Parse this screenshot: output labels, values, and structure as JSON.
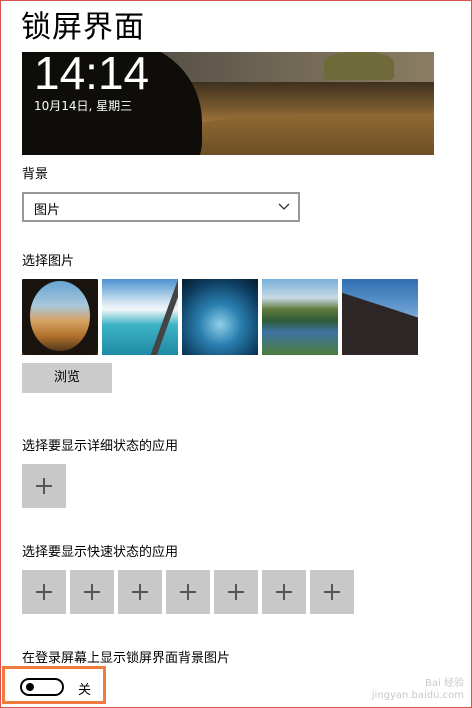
{
  "page": {
    "title": "锁屏界面"
  },
  "preview": {
    "time": "14:14",
    "date": "10月14日, 星期三"
  },
  "background": {
    "label": "背景",
    "selected": "图片"
  },
  "choose_picture": {
    "label": "选择图片",
    "browse_label": "浏览"
  },
  "detailed_status": {
    "label": "选择要显示详细状态的应用"
  },
  "quick_status": {
    "label": "选择要显示快速状态的应用"
  },
  "signin_background": {
    "label": "在登录屏幕上显示锁屏界面背景图片",
    "state": "关"
  },
  "watermark": {
    "line1": "Bai 经验",
    "line2": "jingyan.baidu.com"
  },
  "colors": {
    "highlight": "#f07b3f",
    "tile": "#c8c8c8"
  }
}
